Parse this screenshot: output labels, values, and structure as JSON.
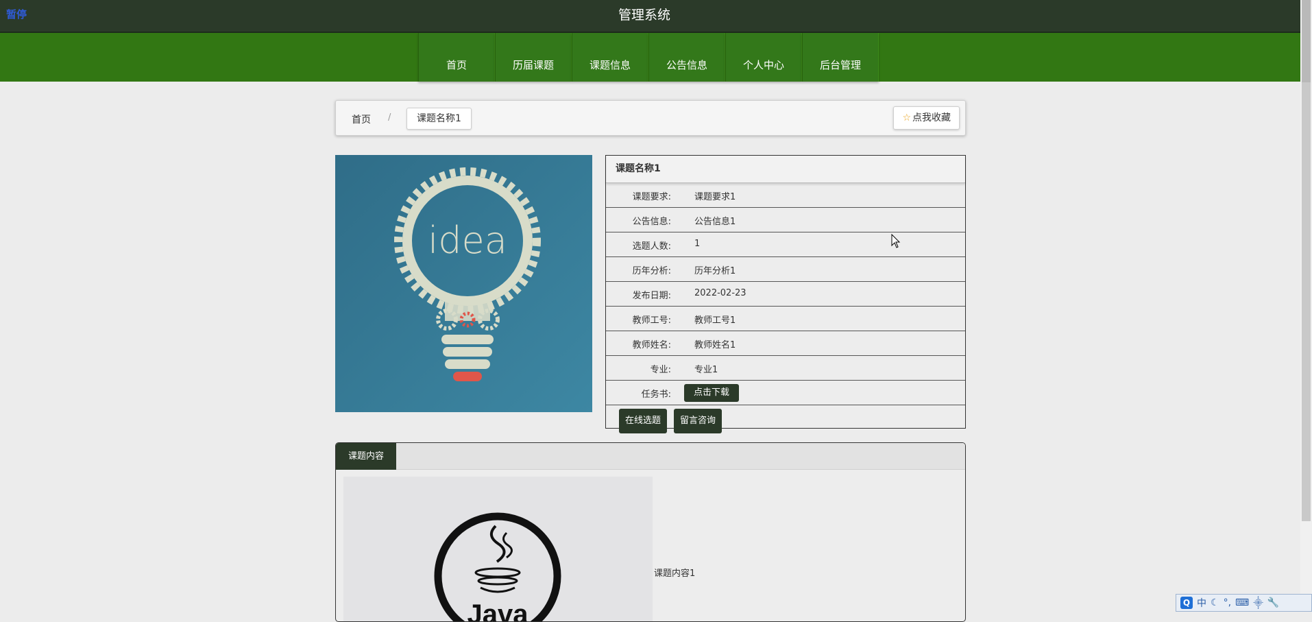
{
  "topbar": {
    "pause_label": "暂停",
    "title": "管理系统"
  },
  "nav": {
    "items": [
      "首页",
      "历届课题",
      "课题信息",
      "公告信息",
      "个人中心",
      "后台管理"
    ]
  },
  "breadcrumb": {
    "home": "首页",
    "separator": "/",
    "current": "课题名称1"
  },
  "favorite_button": {
    "label": "点我收藏",
    "icon": "star-icon"
  },
  "cover_image": {
    "text": "idea",
    "background": "#3a7d97"
  },
  "detail": {
    "name": "课题名称1",
    "rows": [
      {
        "label": "课题要求:",
        "value": "课题要求1"
      },
      {
        "label": "公告信息:",
        "value": "公告信息1"
      },
      {
        "label": "选题人数:",
        "value": "1"
      },
      {
        "label": "历年分析:",
        "value": "历年分析1"
      },
      {
        "label": "发布日期:",
        "value": "2022-02-23"
      },
      {
        "label": "教师工号:",
        "value": "教师工号1"
      },
      {
        "label": "教师姓名:",
        "value": "教师姓名1"
      },
      {
        "label": "专业:",
        "value": "专业1"
      }
    ],
    "task_label": "任务书:",
    "download_label": "点击下载",
    "select_label": "在线选题",
    "consult_label": "留言咨询"
  },
  "content": {
    "tab_label": "课题内容",
    "image_text": "Java",
    "text": "课题内容1"
  },
  "tray": {
    "logo": "Q",
    "ime_label": "中"
  },
  "colors": {
    "dark": "#2b3a29",
    "nav_green": "#327713",
    "background": "#ececec"
  }
}
